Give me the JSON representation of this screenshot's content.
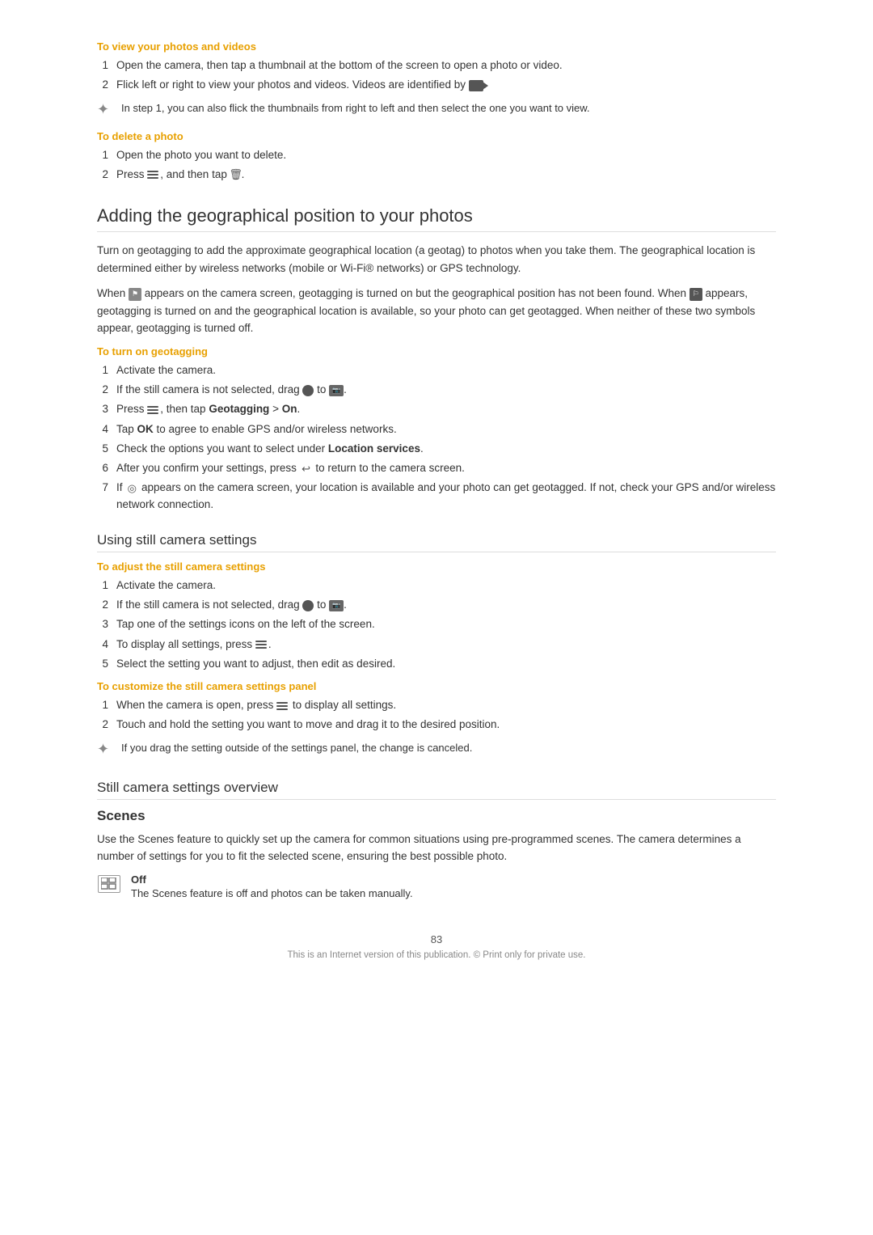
{
  "sections": {
    "view_photos": {
      "heading": "To view your photos and videos",
      "steps": [
        "Open the camera, then tap a thumbnail at the bottom of the screen to open a photo or video.",
        "Flick left or right to view your photos and videos. Videos are identified by"
      ],
      "tip": "In step 1, you can also flick the thumbnails from right to left and then select the one you want to view."
    },
    "delete_photo": {
      "heading": "To delete a photo",
      "steps": [
        "Open the photo you want to delete.",
        "Press"
      ]
    },
    "geo_section": {
      "main_heading": "Adding the geographical position to your photos",
      "body1": "Turn on geotagging to add the approximate geographical location (a geotag) to photos when you take them. The geographical location is determined either by wireless networks (mobile or Wi-Fi® networks) or GPS technology.",
      "body2_prefix": "When",
      "body2_mid1": "appears on the camera screen, geotagging is turned on but the geographical position has not been found. When",
      "body2_mid2": "appears, geotagging is turned on and the geographical location is available, so your photo can get geotagged. When neither of these two symbols appear, geotagging is turned off."
    },
    "turn_on_geo": {
      "heading": "To turn on geotagging",
      "steps": [
        "Activate the camera.",
        "If the still camera is not selected, drag",
        "Press",
        "Tap OK to agree to enable GPS and/or wireless networks.",
        "Check the options you want to select under",
        "After you confirm your settings, press",
        "If"
      ],
      "step2_suffix": "to",
      "step3_suffix": ", then tap Geotagging > On.",
      "step5_suffix": "Location services.",
      "step6_suffix": "to return to the camera screen.",
      "step7_text": "appears on the camera screen, your location is available and your photo can get geotagged. If not, check your GPS and/or wireless network connection."
    },
    "still_camera": {
      "sub_heading": "Using still camera settings",
      "adjust_heading": "To adjust the still camera settings",
      "adjust_steps": [
        "Activate the camera.",
        "If the still camera is not selected, drag",
        "Tap one of the settings icons on the left of the screen.",
        "To display all settings, press",
        "Select the setting you want to adjust, then edit as desired."
      ],
      "step2_suffix": "to",
      "step4_suffix": ".",
      "customize_heading": "To customize the still camera settings panel",
      "customize_steps": [
        "When the camera is open, press",
        "Touch and hold the setting you want to move and drag it to the desired position."
      ],
      "step1_suffix": "to display all settings.",
      "tip": "If you drag the setting outside of the settings panel, the change is canceled."
    },
    "overview": {
      "sub_heading": "Still camera settings overview"
    },
    "scenes": {
      "heading": "Scenes",
      "body": "Use the Scenes feature to quickly set up the camera for common situations using pre-programmed scenes. The camera determines a number of settings for you to fit the selected scene, ensuring the best possible photo.",
      "items": [
        {
          "icon_label": "grid",
          "label": "Off",
          "desc": "The Scenes feature is off and photos can be taken manually."
        }
      ]
    }
  },
  "footer": {
    "page_number": "83",
    "note": "This is an Internet version of this publication. © Print only for private use."
  },
  "labels": {
    "geotagging_menu": "Geotagging > On",
    "location_services": "Location services",
    "bold_geotagging": "Geotagging",
    "bold_on": "On",
    "bold_location": "Location services"
  }
}
